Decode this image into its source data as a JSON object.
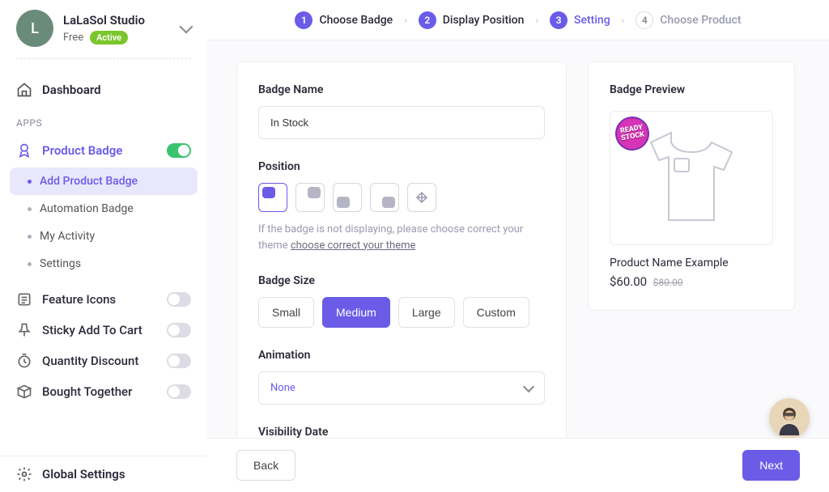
{
  "studio": {
    "initial": "L",
    "name": "LaLaSol Studio",
    "plan": "Free",
    "status": "Active"
  },
  "nav": {
    "dashboard": "Dashboard",
    "apps_label": "APPS",
    "global_settings": "Global Settings"
  },
  "apps": {
    "product_badge": {
      "label": "Product Badge",
      "on": true
    },
    "feature_icons": {
      "label": "Feature Icons"
    },
    "sticky_cart": {
      "label": "Sticky Add To Cart"
    },
    "quantity_discount": {
      "label": "Quantity Discount"
    },
    "bought_together": {
      "label": "Bought Together"
    }
  },
  "product_badge_sub": [
    {
      "label": "Add Product Badge",
      "active": true
    },
    {
      "label": "Automation Badge"
    },
    {
      "label": "My Activity"
    },
    {
      "label": "Settings"
    }
  ],
  "steps": [
    {
      "num": "1",
      "label": "Choose Badge",
      "state": "done"
    },
    {
      "num": "2",
      "label": "Display Position",
      "state": "done"
    },
    {
      "num": "3",
      "label": "Setting",
      "state": "current"
    },
    {
      "num": "4",
      "label": "Choose Product",
      "state": "pending"
    }
  ],
  "form": {
    "badge_name_label": "Badge Name",
    "badge_name_value": "In Stock",
    "position_label": "Position",
    "position_help_1": "If the badge is not displaying, please choose correct your theme ",
    "position_help_link": "choose correct your theme",
    "badge_size_label": "Badge Size",
    "sizes": [
      "Small",
      "Medium",
      "Large",
      "Custom"
    ],
    "size_selected": "Medium",
    "animation_label": "Animation",
    "animation_value": "None",
    "visibility_label": "Visibility Date"
  },
  "preview": {
    "title": "Badge Preview",
    "badge_text": "READY STOCK",
    "product_name": "Product Name Example",
    "price": "$60.00",
    "old_price": "$80.00"
  },
  "footer": {
    "back": "Back",
    "next": "Next"
  }
}
